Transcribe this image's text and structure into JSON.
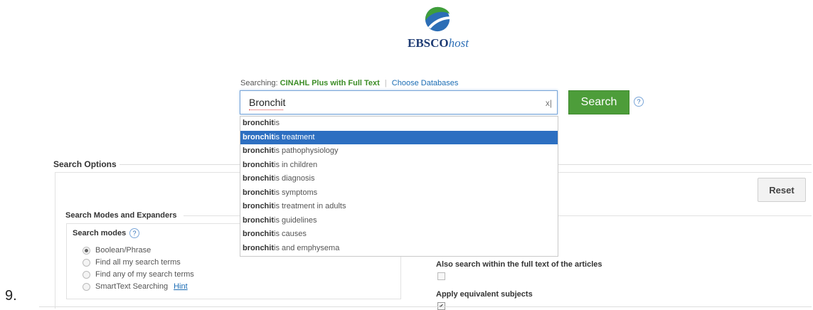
{
  "logo": {
    "text_main": "EBSCO",
    "text_italic": "host"
  },
  "searching": {
    "label": "Searching:",
    "database": "CINAHL Plus with Full Text",
    "choose_databases": "Choose Databases"
  },
  "search": {
    "query": "Bronchit",
    "clear_icon": "x|",
    "button_label": "Search"
  },
  "suggestions": [
    {
      "bold": "bronchit",
      "rest": "is",
      "active": false
    },
    {
      "bold": "bronchit",
      "rest": "is treatment",
      "active": true
    },
    {
      "bold": "bronchit",
      "rest": "is pathophysiology",
      "active": false
    },
    {
      "bold": "bronchit",
      "rest": "is in children",
      "active": false
    },
    {
      "bold": "bronchit",
      "rest": "is diagnosis",
      "active": false
    },
    {
      "bold": "bronchit",
      "rest": "is symptoms",
      "active": false
    },
    {
      "bold": "bronchit",
      "rest": "is treatment in adults",
      "active": false
    },
    {
      "bold": "bronchit",
      "rest": "is guidelines",
      "active": false
    },
    {
      "bold": "bronchit",
      "rest": "is causes",
      "active": false
    },
    {
      "bold": "bronchit",
      "rest": "is and emphysema",
      "active": false
    }
  ],
  "options": {
    "title": "Search Options",
    "reset_label": "Reset",
    "modes_title": "Search Modes and Expanders",
    "search_modes_label": "Search modes",
    "modes": [
      {
        "label": "Boolean/Phrase",
        "selected": true
      },
      {
        "label": "Find all my search terms",
        "selected": false
      },
      {
        "label": "Find any of my search terms",
        "selected": false
      },
      {
        "label": "SmartText Searching",
        "selected": false
      }
    ],
    "hint_link": "Hint",
    "fulltext_label": "Also search within the full text of the articles",
    "fulltext_checked": false,
    "subjects_label": "Apply equivalent subjects",
    "subjects_checked": true
  },
  "list_number": "9.",
  "colors": {
    "accent_green": "#4d9d3a",
    "link_blue": "#1b6cb4",
    "highlight_blue": "#2d6fc1"
  },
  "icons": [
    "ebsco-logo-icon",
    "clear-icon",
    "help-icon",
    "radio-icon",
    "checkbox-icon"
  ]
}
